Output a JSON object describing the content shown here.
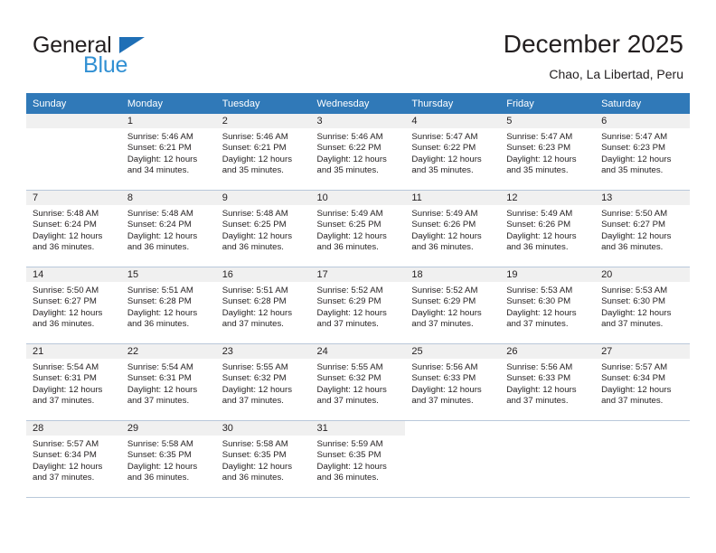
{
  "brand": {
    "name_part1": "General",
    "name_part2": "Blue",
    "triangle_color": "#1f6fb6",
    "blue_color": "#3190d3"
  },
  "header": {
    "title": "December 2025",
    "location": "Chao, La Libertad, Peru"
  },
  "theme": {
    "header_row_bg": "#3079b8",
    "daynum_band_bg": "#f0f0f0",
    "grid_line": "#b9c8da",
    "text": "#231f20"
  },
  "weekdays": [
    "Sunday",
    "Monday",
    "Tuesday",
    "Wednesday",
    "Thursday",
    "Friday",
    "Saturday"
  ],
  "weeks": [
    [
      {
        "day": "",
        "empty": true,
        "sunrise": "",
        "sunset": "",
        "daylight_1": "",
        "daylight_2": ""
      },
      {
        "day": "1",
        "sunrise": "Sunrise: 5:46 AM",
        "sunset": "Sunset: 6:21 PM",
        "daylight_1": "Daylight: 12 hours",
        "daylight_2": "and 34 minutes."
      },
      {
        "day": "2",
        "sunrise": "Sunrise: 5:46 AM",
        "sunset": "Sunset: 6:21 PM",
        "daylight_1": "Daylight: 12 hours",
        "daylight_2": "and 35 minutes."
      },
      {
        "day": "3",
        "sunrise": "Sunrise: 5:46 AM",
        "sunset": "Sunset: 6:22 PM",
        "daylight_1": "Daylight: 12 hours",
        "daylight_2": "and 35 minutes."
      },
      {
        "day": "4",
        "sunrise": "Sunrise: 5:47 AM",
        "sunset": "Sunset: 6:22 PM",
        "daylight_1": "Daylight: 12 hours",
        "daylight_2": "and 35 minutes."
      },
      {
        "day": "5",
        "sunrise": "Sunrise: 5:47 AM",
        "sunset": "Sunset: 6:23 PM",
        "daylight_1": "Daylight: 12 hours",
        "daylight_2": "and 35 minutes."
      },
      {
        "day": "6",
        "sunrise": "Sunrise: 5:47 AM",
        "sunset": "Sunset: 6:23 PM",
        "daylight_1": "Daylight: 12 hours",
        "daylight_2": "and 35 minutes."
      }
    ],
    [
      {
        "day": "7",
        "sunrise": "Sunrise: 5:48 AM",
        "sunset": "Sunset: 6:24 PM",
        "daylight_1": "Daylight: 12 hours",
        "daylight_2": "and 36 minutes."
      },
      {
        "day": "8",
        "sunrise": "Sunrise: 5:48 AM",
        "sunset": "Sunset: 6:24 PM",
        "daylight_1": "Daylight: 12 hours",
        "daylight_2": "and 36 minutes."
      },
      {
        "day": "9",
        "sunrise": "Sunrise: 5:48 AM",
        "sunset": "Sunset: 6:25 PM",
        "daylight_1": "Daylight: 12 hours",
        "daylight_2": "and 36 minutes."
      },
      {
        "day": "10",
        "sunrise": "Sunrise: 5:49 AM",
        "sunset": "Sunset: 6:25 PM",
        "daylight_1": "Daylight: 12 hours",
        "daylight_2": "and 36 minutes."
      },
      {
        "day": "11",
        "sunrise": "Sunrise: 5:49 AM",
        "sunset": "Sunset: 6:26 PM",
        "daylight_1": "Daylight: 12 hours",
        "daylight_2": "and 36 minutes."
      },
      {
        "day": "12",
        "sunrise": "Sunrise: 5:49 AM",
        "sunset": "Sunset: 6:26 PM",
        "daylight_1": "Daylight: 12 hours",
        "daylight_2": "and 36 minutes."
      },
      {
        "day": "13",
        "sunrise": "Sunrise: 5:50 AM",
        "sunset": "Sunset: 6:27 PM",
        "daylight_1": "Daylight: 12 hours",
        "daylight_2": "and 36 minutes."
      }
    ],
    [
      {
        "day": "14",
        "sunrise": "Sunrise: 5:50 AM",
        "sunset": "Sunset: 6:27 PM",
        "daylight_1": "Daylight: 12 hours",
        "daylight_2": "and 36 minutes."
      },
      {
        "day": "15",
        "sunrise": "Sunrise: 5:51 AM",
        "sunset": "Sunset: 6:28 PM",
        "daylight_1": "Daylight: 12 hours",
        "daylight_2": "and 36 minutes."
      },
      {
        "day": "16",
        "sunrise": "Sunrise: 5:51 AM",
        "sunset": "Sunset: 6:28 PM",
        "daylight_1": "Daylight: 12 hours",
        "daylight_2": "and 37 minutes."
      },
      {
        "day": "17",
        "sunrise": "Sunrise: 5:52 AM",
        "sunset": "Sunset: 6:29 PM",
        "daylight_1": "Daylight: 12 hours",
        "daylight_2": "and 37 minutes."
      },
      {
        "day": "18",
        "sunrise": "Sunrise: 5:52 AM",
        "sunset": "Sunset: 6:29 PM",
        "daylight_1": "Daylight: 12 hours",
        "daylight_2": "and 37 minutes."
      },
      {
        "day": "19",
        "sunrise": "Sunrise: 5:53 AM",
        "sunset": "Sunset: 6:30 PM",
        "daylight_1": "Daylight: 12 hours",
        "daylight_2": "and 37 minutes."
      },
      {
        "day": "20",
        "sunrise": "Sunrise: 5:53 AM",
        "sunset": "Sunset: 6:30 PM",
        "daylight_1": "Daylight: 12 hours",
        "daylight_2": "and 37 minutes."
      }
    ],
    [
      {
        "day": "21",
        "sunrise": "Sunrise: 5:54 AM",
        "sunset": "Sunset: 6:31 PM",
        "daylight_1": "Daylight: 12 hours",
        "daylight_2": "and 37 minutes."
      },
      {
        "day": "22",
        "sunrise": "Sunrise: 5:54 AM",
        "sunset": "Sunset: 6:31 PM",
        "daylight_1": "Daylight: 12 hours",
        "daylight_2": "and 37 minutes."
      },
      {
        "day": "23",
        "sunrise": "Sunrise: 5:55 AM",
        "sunset": "Sunset: 6:32 PM",
        "daylight_1": "Daylight: 12 hours",
        "daylight_2": "and 37 minutes."
      },
      {
        "day": "24",
        "sunrise": "Sunrise: 5:55 AM",
        "sunset": "Sunset: 6:32 PM",
        "daylight_1": "Daylight: 12 hours",
        "daylight_2": "and 37 minutes."
      },
      {
        "day": "25",
        "sunrise": "Sunrise: 5:56 AM",
        "sunset": "Sunset: 6:33 PM",
        "daylight_1": "Daylight: 12 hours",
        "daylight_2": "and 37 minutes."
      },
      {
        "day": "26",
        "sunrise": "Sunrise: 5:56 AM",
        "sunset": "Sunset: 6:33 PM",
        "daylight_1": "Daylight: 12 hours",
        "daylight_2": "and 37 minutes."
      },
      {
        "day": "27",
        "sunrise": "Sunrise: 5:57 AM",
        "sunset": "Sunset: 6:34 PM",
        "daylight_1": "Daylight: 12 hours",
        "daylight_2": "and 37 minutes."
      }
    ],
    [
      {
        "day": "28",
        "sunrise": "Sunrise: 5:57 AM",
        "sunset": "Sunset: 6:34 PM",
        "daylight_1": "Daylight: 12 hours",
        "daylight_2": "and 37 minutes."
      },
      {
        "day": "29",
        "sunrise": "Sunrise: 5:58 AM",
        "sunset": "Sunset: 6:35 PM",
        "daylight_1": "Daylight: 12 hours",
        "daylight_2": "and 36 minutes."
      },
      {
        "day": "30",
        "sunrise": "Sunrise: 5:58 AM",
        "sunset": "Sunset: 6:35 PM",
        "daylight_1": "Daylight: 12 hours",
        "daylight_2": "and 36 minutes."
      },
      {
        "day": "31",
        "sunrise": "Sunrise: 5:59 AM",
        "sunset": "Sunset: 6:35 PM",
        "daylight_1": "Daylight: 12 hours",
        "daylight_2": "and 36 minutes."
      },
      {
        "day": "",
        "blank": true,
        "sunrise": "",
        "sunset": "",
        "daylight_1": "",
        "daylight_2": ""
      },
      {
        "day": "",
        "blank": true,
        "sunrise": "",
        "sunset": "",
        "daylight_1": "",
        "daylight_2": ""
      },
      {
        "day": "",
        "blank": true,
        "sunrise": "",
        "sunset": "",
        "daylight_1": "",
        "daylight_2": ""
      }
    ]
  ]
}
